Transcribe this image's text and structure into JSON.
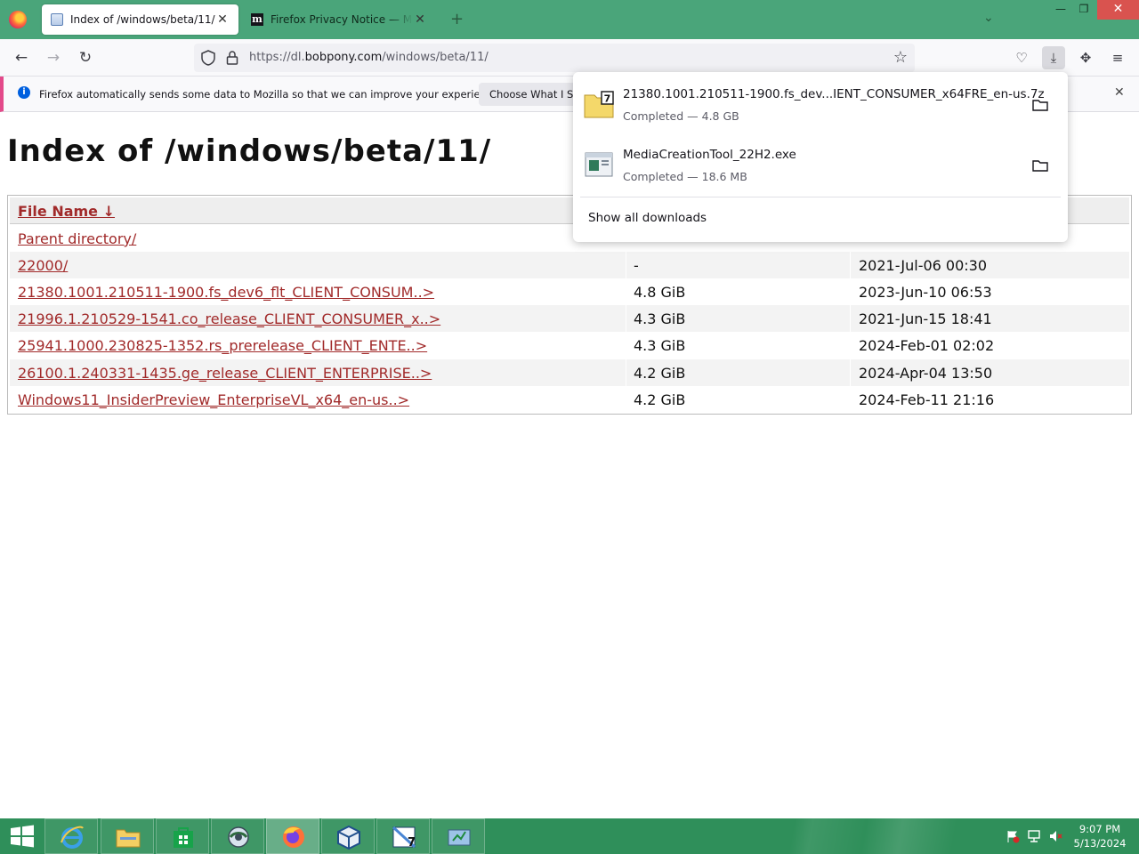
{
  "browser": {
    "tabs": [
      {
        "title": "Index of /windows/beta/11/",
        "active": true
      },
      {
        "title": "Firefox Privacy Notice — Mozilla",
        "active": false
      }
    ],
    "url_prefix": "https://dl.",
    "url_domain": "bobpony.com",
    "url_path": "/windows/beta/11/"
  },
  "notification": {
    "message": "Firefox automatically sends some data to Mozilla so that we can improve your experience.",
    "button": "Choose What I Share"
  },
  "page": {
    "title": "Index of /windows/beta/11/",
    "header_name": "File Name  ↓",
    "parent": "Parent directory/",
    "rows": [
      {
        "name": "22000/",
        "size": "-",
        "date": "2021-Jul-06 00:30"
      },
      {
        "name": "21380.1001.210511-1900.fs_dev6_flt_CLIENT_CONSUM..>",
        "size": "4.8 GiB",
        "date": "2023-Jun-10 06:53"
      },
      {
        "name": "21996.1.210529-1541.co_release_CLIENT_CONSUMER_x..>",
        "size": "4.3 GiB",
        "date": "2021-Jun-15 18:41"
      },
      {
        "name": "25941.1000.230825-1352.rs_prerelease_CLIENT_ENTE..>",
        "size": "4.3 GiB",
        "date": "2024-Feb-01 02:02"
      },
      {
        "name": "26100.1.240331-1435.ge_release_CLIENT_ENTERPRISE..>",
        "size": "4.2 GiB",
        "date": "2024-Apr-04 13:50"
      },
      {
        "name": "Windows11_InsiderPreview_EnterpriseVL_x64_en-us..>",
        "size": "4.2 GiB",
        "date": "2024-Feb-11 21:16"
      }
    ]
  },
  "downloads": {
    "items": [
      {
        "name": "21380.1001.210511-1900.fs_dev...IENT_CONSUMER_x64FRE_en-us.7z",
        "status": "Completed — 4.8 GB",
        "icon": "7z-archive-icon"
      },
      {
        "name": "MediaCreationTool_22H2.exe",
        "status": "Completed — 18.6 MB",
        "icon": "exe-icon"
      }
    ],
    "show_all": "Show all downloads"
  },
  "taskbar": {
    "time": "9:07 PM",
    "date": "5/13/2024"
  },
  "colors": {
    "tabstrip": "#4aa57a",
    "taskbar": "#2f8f5a",
    "link": "#a12a2a"
  }
}
